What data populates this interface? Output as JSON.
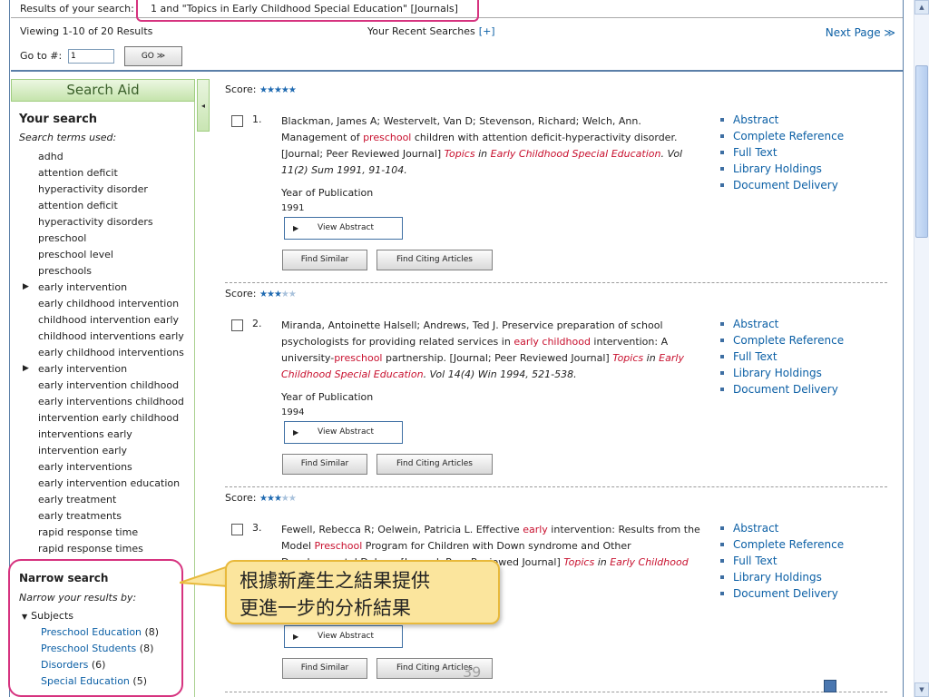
{
  "header": {
    "results_label": "Results of your search:",
    "query": "1 and \"Topics in Early Childhood Special Education\" [Journals]",
    "viewing": "Viewing 1-10 of 20 Results",
    "recent_label": "Your Recent Searches",
    "recent_plus": "[+]",
    "next_page": "Next Page ≫",
    "goto_label": "Go to #:",
    "goto_value": "1",
    "go_button": "GO ≫"
  },
  "sidebar": {
    "title": "Search Aid",
    "collapse_icon": "◂",
    "your_search": "Your search",
    "terms_used": "Search terms used:",
    "terms": [
      "adhd",
      "attention deficit",
      "hyperactivity disorder",
      "attention deficit",
      "hyperactivity disorders",
      "preschool",
      "preschool level",
      "preschools",
      "early intervention",
      "early childhood intervention",
      "childhood intervention early",
      "childhood interventions early",
      "early childhood interventions",
      "early intervention",
      "early intervention childhood",
      "early interventions childhood",
      "intervention early childhood",
      "interventions early",
      "intervention early",
      "early interventions",
      "early intervention education",
      "early treatment",
      "early treatments",
      "rapid response time",
      "rapid response times"
    ],
    "narrow_title": "Narrow search",
    "narrow_by": "Narrow your results by:",
    "subjects_label": "Subjects",
    "facets": [
      {
        "label": "Preschool Education",
        "count": "(8)"
      },
      {
        "label": "Preschool Students",
        "count": "(8)"
      },
      {
        "label": "Disorders",
        "count": "(6)"
      },
      {
        "label": "Special Education",
        "count": "(5)"
      }
    ]
  },
  "results": [
    {
      "score_label": "Score:",
      "stars_on": "★★★★★",
      "stars_off": "",
      "num": "1.",
      "authors": "Blackman, James A; Westervelt, Van D; Stevenson, Richard; Welch, Ann.",
      "t1": "Management of ",
      "t1_hl": "preschool",
      "t2": " children with attention deficit-hyperactivity disorder.",
      "t3": " [Journal; Peer Reviewed Journal] ",
      "j_a": "Topics",
      "j_b": " in ",
      "j_c": "Early Childhood Special Education",
      "vol": ". Vol 11(2) Sum 1991, 91-104.",
      "year_label": "Year of Publication",
      "year": "1991",
      "view_abstract": "View Abstract",
      "find_similar": "Find Similar",
      "find_citing": "Find Citing Articles",
      "links": [
        "Abstract",
        "Complete Reference",
        "Full Text",
        "Library Holdings",
        "Document Delivery"
      ]
    },
    {
      "score_label": "Score:",
      "stars_on": "★★★",
      "stars_off": "★★",
      "num": "2.",
      "authors": "Miranda, Antoinette Halsell; Andrews, Ted J. Preservice preparation of school psychologists for providing related services in ",
      "t1_hl": "early childhood",
      "t2": " intervention: A university-",
      "t2_hl": "preschool",
      "t3": " partnership. [Journal; Peer Reviewed Journal] ",
      "j_a": "Topics",
      "j_b": " in ",
      "j_c": "Early Childhood Special Education",
      "vol": ". Vol 14(4) Win 1994, 521-538.",
      "year_label": "Year of Publication",
      "year": "1994",
      "view_abstract": "View Abstract",
      "find_similar": "Find Similar",
      "find_citing": "Find Citing Articles",
      "links": [
        "Abstract",
        "Complete Reference",
        "Full Text",
        "Library Holdings",
        "Document Delivery"
      ]
    },
    {
      "score_label": "Score:",
      "stars_on": "★★★",
      "stars_off": "★★",
      "num": "3.",
      "authors": "Fewell, Rebecca R; Oelwein, Patricia L. Effective ",
      "t1_hl": "early",
      "t2": " intervention: Results from the Model ",
      "t2_hl": "Preschool",
      "t3": " Program for Children with Down syndrome and Other Developmental Delays. [Journal; Peer Reviewed Journal] ",
      "j_a": "Topics",
      "j_b": " in ",
      "j_c": "Early Childhood",
      "view_abstract": "View Abstract",
      "find_similar": "Find Similar",
      "find_citing": "Find Citing Articles",
      "links": [
        "Abstract",
        "Complete Reference",
        "Full Text",
        "Library Holdings",
        "Document Delivery"
      ]
    }
  ],
  "callout": {
    "line1": "根據新產生之結果提供",
    "line2": "更進一步的分析結果"
  },
  "slide_number": "39",
  "colors": {
    "link": "#0b5fa5",
    "highlight": "#c8102e",
    "annotation": "#d6337f",
    "callout_bg": "#fbe59d"
  }
}
